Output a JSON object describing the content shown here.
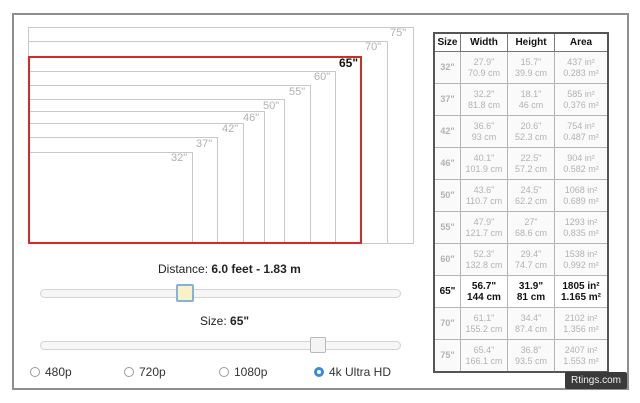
{
  "diagram": {
    "screens": [
      {
        "label": "75\""
      },
      {
        "label": "70\""
      },
      {
        "label": "65\"",
        "selected": true
      },
      {
        "label": "60\""
      },
      {
        "label": "55\""
      },
      {
        "label": "50\""
      },
      {
        "label": "46\""
      },
      {
        "label": "42\""
      },
      {
        "label": "37\""
      },
      {
        "label": "32\""
      }
    ]
  },
  "distance": {
    "label": "Distance:",
    "value": "6.0 feet - 1.83 m"
  },
  "size": {
    "label": "Size:",
    "value": "65\""
  },
  "resolutions": [
    {
      "label": "480p",
      "checked": false
    },
    {
      "label": "720p",
      "checked": false
    },
    {
      "label": "1080p",
      "checked": false
    },
    {
      "label": "4k Ultra HD",
      "checked": true
    }
  ],
  "table": {
    "headers": [
      "Size",
      "Width",
      "Height",
      "Area"
    ],
    "rows": [
      {
        "size": "32\"",
        "width_in": "27.9\"",
        "width_cm": "70.9 cm",
        "height_in": "15.7\"",
        "height_cm": "39.9 cm",
        "area_in": "437 in²",
        "area_m": "0.283 m²"
      },
      {
        "size": "37\"",
        "width_in": "32.2\"",
        "width_cm": "81.8 cm",
        "height_in": "18.1\"",
        "height_cm": "46 cm",
        "area_in": "585 in²",
        "area_m": "0.376 m²"
      },
      {
        "size": "42\"",
        "width_in": "36.6\"",
        "width_cm": "93 cm",
        "height_in": "20.6\"",
        "height_cm": "52.3 cm",
        "area_in": "754 in²",
        "area_m": "0.487 m²"
      },
      {
        "size": "46\"",
        "width_in": "40.1\"",
        "width_cm": "101.9 cm",
        "height_in": "22.5\"",
        "height_cm": "57.2 cm",
        "area_in": "904 in²",
        "area_m": "0.582 m²"
      },
      {
        "size": "50\"",
        "width_in": "43.6\"",
        "width_cm": "110.7 cm",
        "height_in": "24.5\"",
        "height_cm": "62.2 cm",
        "area_in": "1068 in²",
        "area_m": "0.689 m²"
      },
      {
        "size": "55\"",
        "width_in": "47.9\"",
        "width_cm": "121.7 cm",
        "height_in": "27\"",
        "height_cm": "68.6 cm",
        "area_in": "1293 in²",
        "area_m": "0.835 m²"
      },
      {
        "size": "60\"",
        "width_in": "52.3\"",
        "width_cm": "132.8 cm",
        "height_in": "29.4\"",
        "height_cm": "74.7 cm",
        "area_in": "1538 in²",
        "area_m": "0.992 m²"
      },
      {
        "size": "65\"",
        "width_in": "56.7\"",
        "width_cm": "144 cm",
        "height_in": "31.9\"",
        "height_cm": "81 cm",
        "area_in": "1805 in²",
        "area_m": "1.165 m²",
        "highlight": true
      },
      {
        "size": "70\"",
        "width_in": "61.1\"",
        "width_cm": "155.2 cm",
        "height_in": "34.4\"",
        "height_cm": "87.4 cm",
        "area_in": "2102 in²",
        "area_m": "1.356 m²"
      },
      {
        "size": "75\"",
        "width_in": "65.4\"",
        "width_cm": "166.1 cm",
        "height_in": "36.8\"",
        "height_cm": "93.5 cm",
        "area_in": "2407 in²",
        "area_m": "1.553 m²"
      }
    ]
  },
  "watermark": "Rtings.com",
  "colors": {
    "selected_outline": "#d32a2a",
    "accent": "#3b8bd8"
  }
}
